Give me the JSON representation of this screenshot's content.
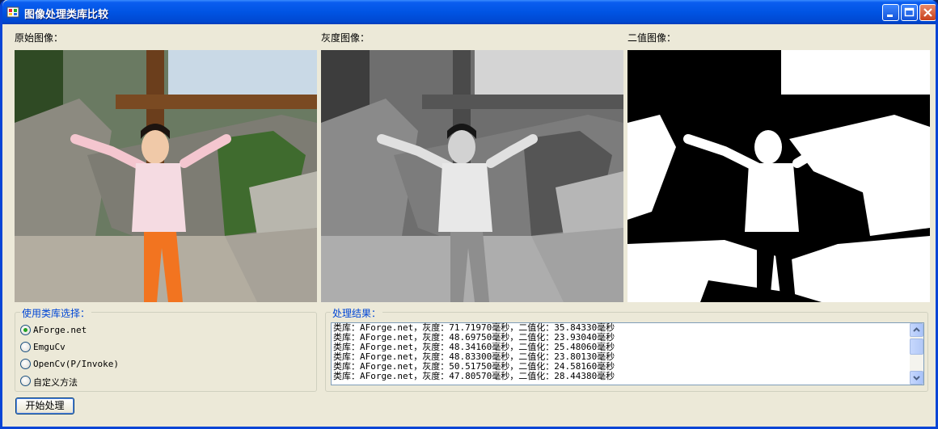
{
  "window": {
    "title": "图像处理类库比较",
    "colors": {
      "titlebar": "#0054e3",
      "face": "#ece9d8",
      "group_title": "#0046d5"
    }
  },
  "images": {
    "original_label": "原始图像：",
    "gray_label": "灰度图像：",
    "binary_label": "二值图像："
  },
  "library_group": {
    "title": "使用类库选择：",
    "options": [
      {
        "label": "AForge.net",
        "selected": true
      },
      {
        "label": "EmguCv",
        "selected": false
      },
      {
        "label": "OpenCv(P/Invoke)",
        "selected": false
      },
      {
        "label": "自定义方法",
        "selected": false
      }
    ]
  },
  "results_group": {
    "title": "处理结果：",
    "lines": [
      "类库：AForge.net，灰度：71.71970毫秒，二值化：35.84330毫秒",
      "类库：AForge.net，灰度：48.69750毫秒，二值化：23.93040毫秒",
      "类库：AForge.net，灰度：48.34160毫秒，二值化：25.48060毫秒",
      "类库：AForge.net，灰度：48.83300毫秒，二值化：23.80130毫秒",
      "类库：AForge.net，灰度：50.51750毫秒，二值化：24.58160毫秒",
      "类库：AForge.net，灰度：47.80570毫秒，二值化：28.44380毫秒"
    ]
  },
  "start_button": "开始处理"
}
